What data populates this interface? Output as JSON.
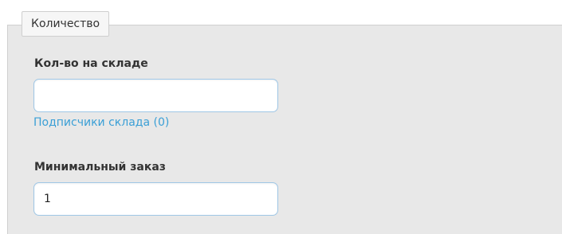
{
  "fieldset": {
    "legend": "Количество"
  },
  "stock_quantity": {
    "label": "Кол-во на складе",
    "value": "",
    "subscribers_link": "Подписчики склада (0)"
  },
  "minimum_order": {
    "label": "Минимальный заказ",
    "value": "1"
  },
  "colors": {
    "panel_background": "#e8e8e8",
    "input_border": "#9fc7e6",
    "link": "#3a9fd6"
  }
}
